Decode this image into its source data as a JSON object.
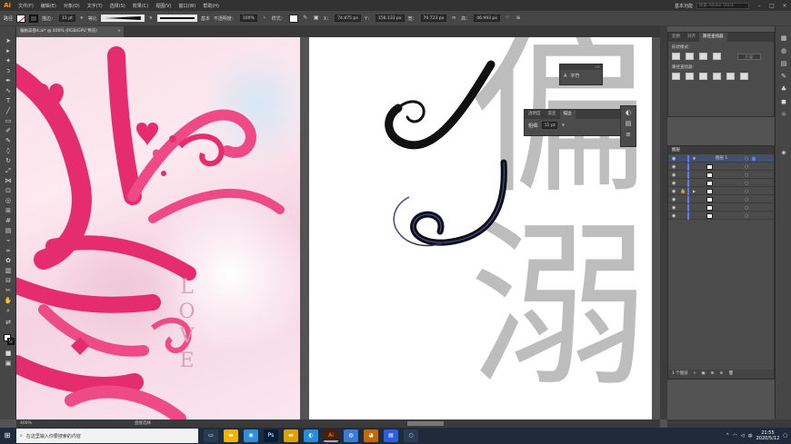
{
  "menubar": {
    "logo": "Ai",
    "items": [
      "文件(F)",
      "编辑(E)",
      "对象(O)",
      "文字(T)",
      "选择(S)",
      "效果(C)",
      "视图(V)",
      "窗口(W)",
      "帮助(H)"
    ],
    "workspace": "基本功能",
    "search_placeholder": "搜索 Adobe Stock"
  },
  "controlbar": {
    "selection_label": "路径",
    "stroke_label": "描边：",
    "stroke_weight": "11 pt",
    "profile_label": "等比",
    "brush_label": "基本",
    "opacity_label": "不透明度：",
    "opacity_value": "100%",
    "style_label": "样式：",
    "x_label": "X：",
    "x_value": "74.875 px",
    "y_label": "Y：",
    "y_value": "156.133 px",
    "w_label": "宽：",
    "w_value": "70.723 px",
    "h_label": "高：",
    "h_value": "46.993 px"
  },
  "tabs": [
    {
      "label": "偏执美兽4.ai* @ 400% (RGB/GPU 预览)",
      "close": "×"
    }
  ],
  "canvas": {
    "love_text": "LOVE",
    "big_chars": [
      "偏",
      "溺"
    ]
  },
  "float_panels": {
    "char_panel": {
      "label": "字符",
      "icon": "A"
    },
    "stroke_panel": {
      "tabs": [
        "透明度",
        "渐变",
        "描边"
      ],
      "active_tab": "描边",
      "weight_label": "粗细:",
      "weight_value": "11 pt"
    }
  },
  "right_panel": {
    "tabs": [
      "变换",
      "对齐",
      "路径查找器"
    ],
    "active_tab": "路径查找器",
    "shape_modes_label": "形状模式：",
    "pathfinder_label": "路径查找器：",
    "expand_label": "扩展"
  },
  "layers": {
    "tab": "图层",
    "rows": [
      {
        "name": "图层 1",
        "selected": true,
        "expanded": true
      },
      {
        "name": "",
        "selected": false
      },
      {
        "name": "",
        "selected": false
      },
      {
        "name": "",
        "selected": false
      },
      {
        "name": "",
        "selected": false
      },
      {
        "name": "",
        "selected": false
      },
      {
        "name": "",
        "selected": false
      },
      {
        "name": "",
        "selected": false
      }
    ],
    "footer": "1 个图层"
  },
  "statusbar": {
    "zoom": "400%",
    "tool": "直接选择"
  },
  "taskbar": {
    "search_placeholder": "在这里输入你要搜索的内容",
    "time": "21:55",
    "date": "2020/5/12",
    "ime": "中"
  },
  "colors": {
    "accent_pink": "#e52d6e",
    "stroke_black": "#111111",
    "gray_char": "#bdbdbd",
    "layer_blue": "#5b7cf0"
  }
}
